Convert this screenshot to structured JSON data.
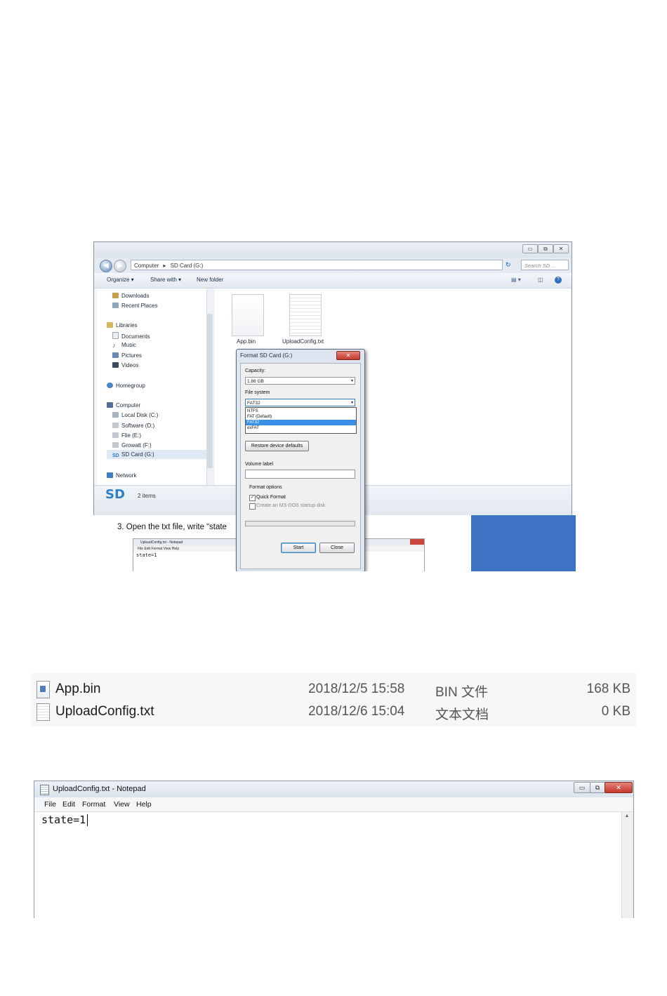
{
  "explorer": {
    "window_buttons": [
      "▭",
      "⧉",
      "✕"
    ],
    "address_parts": [
      "Computer",
      "▸",
      "SD Card (G:)"
    ],
    "search_placeholder": "Search SD ...",
    "toolbar": {
      "organize": "Organize ▾",
      "share_with": "Share with ▾",
      "new_folder": "New folder"
    },
    "nav_items": [
      {
        "label": "Downloads",
        "icon": "downloads-icon"
      },
      {
        "label": "Recent Places",
        "icon": "recent-places-icon"
      },
      {
        "label": "Libraries",
        "icon": "libraries-icon"
      },
      {
        "label": "Documents",
        "icon": "documents-icon"
      },
      {
        "label": "Music",
        "icon": "music-icon"
      },
      {
        "label": "Pictures",
        "icon": "pictures-icon"
      },
      {
        "label": "Videos",
        "icon": "videos-icon"
      },
      {
        "label": "Homegroup",
        "icon": "homegroup-icon"
      },
      {
        "label": "Computer",
        "icon": "computer-icon"
      },
      {
        "label": "Local Disk (C:)",
        "icon": "drive-icon"
      },
      {
        "label": "Software (D:)",
        "icon": "drive-icon"
      },
      {
        "label": "Flie (E:)",
        "icon": "drive-icon"
      },
      {
        "label": "Growatt (F:)",
        "icon": "drive-icon"
      },
      {
        "label": "SD Card (G:)",
        "icon": "sd-card-icon"
      },
      {
        "label": "Network",
        "icon": "network-icon"
      }
    ],
    "files": [
      "App.bin",
      "UploadConfig.txt"
    ],
    "details_icon": "SD",
    "items_count": "2 items"
  },
  "background_doc": {
    "step_text": "3.  Open the txt file, write “state",
    "mini_notepad": {
      "title": "UploadConfig.txt - Notepad",
      "menu": "File  Edit  Format  View  Help",
      "content": "state=1"
    }
  },
  "format_dialog": {
    "title": "Format SD Card (G:)",
    "close_label": "✕",
    "capacity_label": "Capacity:",
    "capacity_value": "1.86 GB",
    "file_system_label": "File system",
    "file_system_value": "FAT32",
    "file_system_options": [
      "NTFS",
      "FAT (Default)",
      "FAT32",
      "exFAT"
    ],
    "file_system_selected_index": 2,
    "restore_button": "Restore device defaults",
    "volume_label": "Volume label",
    "volume_value": "",
    "format_options_label": "Format options",
    "quick_format_label": "Quick Format",
    "quick_format_checked": true,
    "msdos_label": "Create an MS-DOS startup disk",
    "msdos_checked": false,
    "start_button": "Start",
    "close_button": "Close"
  },
  "file_listing": {
    "rows": [
      {
        "name": "App.bin",
        "date": "2018/12/5 15:58",
        "type": "BIN 文件",
        "size": "168 KB",
        "icon": "bin-file-icon"
      },
      {
        "name": "UploadConfig.txt",
        "date": "2018/12/6 15:04",
        "type": "文本文档",
        "size": "0 KB",
        "icon": "text-file-icon"
      }
    ]
  },
  "notepad": {
    "title": "UploadConfig.txt - Notepad",
    "window_buttons": [
      "▭",
      "⧉",
      "✕"
    ],
    "menu": [
      "File",
      "Edit",
      "Format",
      "View",
      "Help"
    ],
    "content": "state=1"
  },
  "colors": {
    "accent_blue": "#3e72c2",
    "selection": "#3a8ee6",
    "close_red": "#c5392c"
  }
}
